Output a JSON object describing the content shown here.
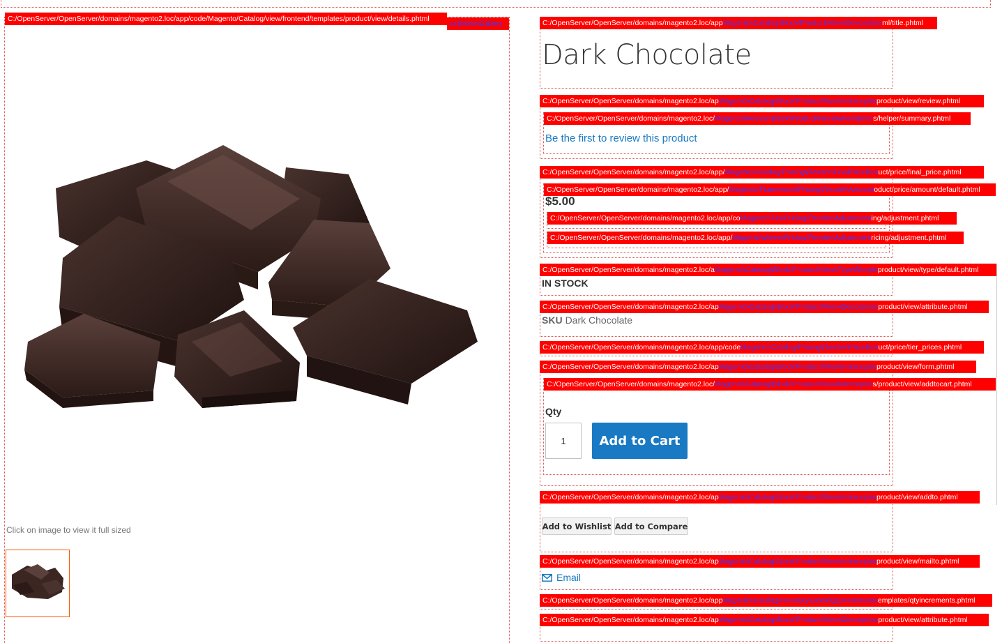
{
  "product": {
    "title": "Dark Chocolate",
    "review_link": "Be the first to review this product",
    "price": "$5.00",
    "stock": "IN STOCK",
    "sku_label": "SKU",
    "sku_value": "Dark Chocolate",
    "qty_label": "Qty",
    "qty_value": "1",
    "add_to_cart": "Add to Cart",
    "add_to_wishlist": "Add to Wishlist",
    "add_to_compare": "Add to Compare",
    "email": "Email"
  },
  "gallery": {
    "caption": "Click on image to view it full sized",
    "image_icon": "chocolate-pieces-image",
    "thumbnail_icon": "chocolate-thumbnail-image"
  },
  "hints": {
    "details": {
      "path": "C:/OpenServer/OpenServer/domains/magento2.loc/app/code/Magento/Catalog/view/frontend/templates/product/view/details.phtml",
      "cls": "",
      "tail": ""
    },
    "gallery_tail": {
      "path": "",
      "cls": "uct\\View\\Gallery",
      "tail": ""
    },
    "title": {
      "path": "C:/OpenServer/OpenServer/domains/magento2.loc/app",
      "cls": "Magento\\Catalog\\Block\\Product\\View\\Description",
      "tail": "ml/title.phtml"
    },
    "review": {
      "path": "C:/OpenServer/OpenServer/domains/magento2.loc/ap",
      "cls": "Magento\\Catalog\\Block\\Product\\View\\Interceptor",
      "tail": "product/view/review.phtml"
    },
    "summary": {
      "path": "C:/OpenServer/OpenServer/domains/magento2.loc/",
      "cls": "Magento\\Review\\Block\\Product\\ReviewRenderer",
      "tail": "s/helper/summary.phtml"
    },
    "final_price": {
      "path": "C:/OpenServer/OpenServer/domains/magento2.loc/app/",
      "cls": "Magento\\Catalog\\Pricing\\Render\\FinalPriceBox",
      "tail": "uct/price/final_price.phtml"
    },
    "amount": {
      "path": "C:/OpenServer/OpenServer/domains/magento2.loc/app/",
      "cls": "Magento\\Framework\\Pricing\\Render\\Amount",
      "tail": "oduct/price/amount/default.phtml"
    },
    "tax_adj": {
      "path": "C:/OpenServer/OpenServer/domains/magento2.loc/app/co",
      "cls": "Magento\\Tax\\Pricing\\Render\\Adjustment",
      "tail": "ing/adjustment.phtml"
    },
    "weee_adj": {
      "path": "C:/OpenServer/OpenServer/domains/magento2.loc/app/",
      "cls": "Magento\\Weee\\Pricing\\Render\\Adjustment",
      "tail": "ricing/adjustment.phtml"
    },
    "type_default": {
      "path": "C:/OpenServer/OpenServer/domains/magento2.loc/a",
      "cls": "Magento\\Catalog\\Block\\Product\\View\\Type\\Simple",
      "tail": "product/view/type/default.phtml"
    },
    "attribute1": {
      "path": "C:/OpenServer/OpenServer/domains/magento2.loc/ap",
      "cls": "Magento\\Catalog\\Block\\Product\\View\\Description",
      "tail": "product/view/attribute.phtml"
    },
    "tier_prices": {
      "path": "C:/OpenServer/OpenServer/domains/magento2.loc/app/code",
      "cls": "Magento\\Catalog\\Pricing\\Render\\PriceBox",
      "tail": "uct/price/tier_prices.phtml"
    },
    "form": {
      "path": "C:/OpenServer/OpenServer/domains/magento2.loc/ap",
      "cls": "Magento\\Catalog\\Block\\Product\\View\\Interceptor",
      "tail": "product/view/form.phtml"
    },
    "addtocart": {
      "path": "C:/OpenServer/OpenServer/domains/magento2.loc/",
      "cls": "Magento\\Catalog\\Block\\Product\\View\\Interceptor",
      "tail": "s/product/view/addtocart.phtml"
    },
    "addto": {
      "path": "C:/OpenServer/OpenServer/domains/magento2.loc/ap",
      "cls": "Magento\\Catalog\\Block\\Product\\View\\Interceptor",
      "tail": "product/view/addto.phtml"
    },
    "mailto": {
      "path": "C:/OpenServer/OpenServer/domains/magento2.loc/ap",
      "cls": "Magento\\Catalog\\Block\\Product\\View\\Interceptor",
      "tail": "product/view/mailto.phtml"
    },
    "qtyincrements": {
      "path": "C:/OpenServer/OpenServer/domains/magento2.loc/app",
      "cls": "Magento\\CatalogInventory\\Block\\Qtyincrements",
      "tail": "emplates/qtyincrements.phtml"
    },
    "attribute2": {
      "path": "C:/OpenServer/OpenServer/domains/magento2.loc/ap",
      "cls": "Magento\\Catalog\\Block\\Product\\View\\Description",
      "tail": "product/view/attribute.phtml"
    }
  },
  "colors": {
    "hint_bg": "#ff0000",
    "hint_class_text": "#3a3aff",
    "link": "#1979c3",
    "primary_button": "#1979c3",
    "thumb_border": "#ff5501"
  }
}
